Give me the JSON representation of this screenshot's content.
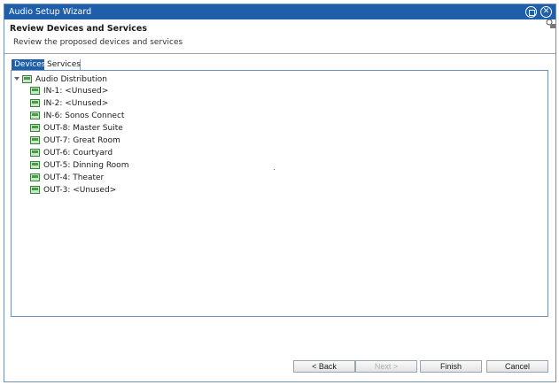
{
  "window": {
    "title": "Audio Setup Wizard"
  },
  "header": {
    "title": "Review Devices and Services",
    "subtitle": "Review the proposed devices and services"
  },
  "tabs": [
    {
      "label": "Devices",
      "active": true
    },
    {
      "label": "Services",
      "active": false
    }
  ],
  "tree": {
    "root": {
      "label": "Audio Distribution",
      "icon": "device-icon",
      "expanded": true
    },
    "items": [
      {
        "label": "IN-1: <Unused>"
      },
      {
        "label": "IN-2: <Unused>"
      },
      {
        "label": "IN-6: Sonos Connect"
      },
      {
        "label": "OUT-8: Master Suite"
      },
      {
        "label": "OUT-7: Great Room"
      },
      {
        "label": "OUT-6: Courtyard"
      },
      {
        "label": "OUT-5: Dinning Room"
      },
      {
        "label": "OUT-4: Theater"
      },
      {
        "label": "OUT-3: <Unused>"
      }
    ]
  },
  "buttons": {
    "back": "< Back",
    "next": "Next >",
    "finish": "Finish",
    "cancel": "Cancel"
  },
  "colors": {
    "accent": "#1f5ea8",
    "device_icon": "#4a9a4a"
  }
}
